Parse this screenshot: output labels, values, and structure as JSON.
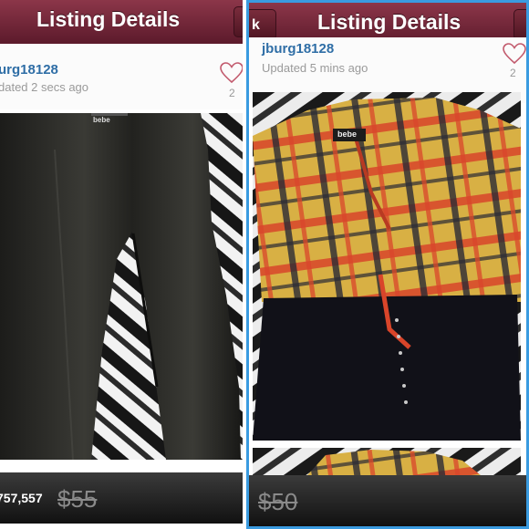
{
  "left_panel": {
    "nav_title": "Listing Details",
    "username": "urg18128",
    "updated": "dated 2 secs ago",
    "like_count": "2",
    "item_label": "bebe",
    "count_text": "757,557",
    "price": "$55"
  },
  "right_panel": {
    "nav_title": "Listing Details",
    "back_label": "k",
    "username": "jburg18128",
    "updated": "Updated 5 mins ago",
    "like_count": "2",
    "item_label": "bebe",
    "price": "$50"
  },
  "colors": {
    "nav_bar": "#6e2538",
    "username": "#2f6ea6",
    "selection_border": "#3a9be0"
  }
}
